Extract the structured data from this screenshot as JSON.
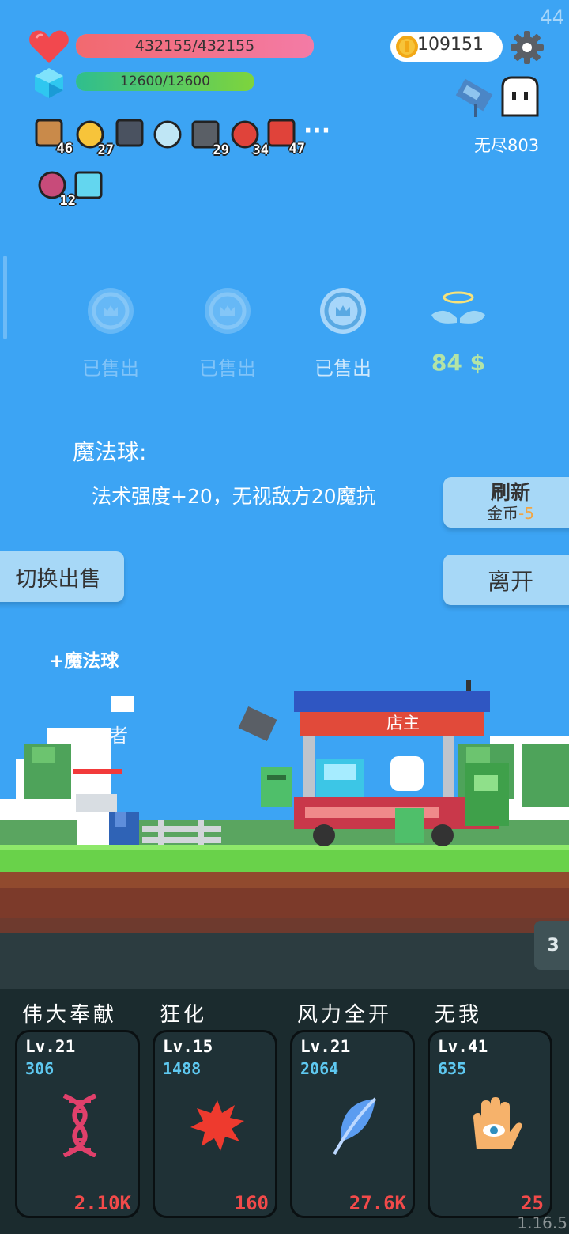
{
  "status": {
    "hp_text": "432155/432155",
    "hp_fraction": 1.0,
    "mana_text": "12600/12600",
    "mana_fraction": 1.0,
    "gold": "109151",
    "fps": "44",
    "stage": "无尽803",
    "version": "1.16.5"
  },
  "inventory": [
    {
      "icon": "shield-item-icon",
      "count": "46"
    },
    {
      "icon": "sun-item-icon",
      "count": "27"
    },
    {
      "icon": "skull-book-item-icon",
      "count": ""
    },
    {
      "icon": "magnifier-item-icon",
      "count": ""
    },
    {
      "icon": "bat-item-icon",
      "count": "29"
    },
    {
      "icon": "sock-item-icon",
      "count": "34"
    },
    {
      "icon": "apple-item-icon",
      "count": "47"
    },
    {
      "icon": "sword-item-icon",
      "count": "12"
    },
    {
      "icon": "lamp-item-icon",
      "count": ""
    }
  ],
  "more_label": "···",
  "shop": {
    "slots": [
      {
        "label": "已售出"
      },
      {
        "label": "已售出"
      },
      {
        "label": "已售出"
      },
      {
        "label": "84 $"
      }
    ],
    "item_title": "魔法球:",
    "item_desc": "法术强度+20，无视敌方20魔抗",
    "refresh_label": "刷新",
    "refresh_cost_label": "金币",
    "refresh_cost_value": "-5",
    "switch_label": "切换出售",
    "leave_label": "离开"
  },
  "scene": {
    "gain_text": "+魔法球",
    "hero_tag": "者",
    "shopkeeper_label": "店主",
    "side_tab_number": "3"
  },
  "skills": [
    {
      "name": "伟大奉献",
      "level": "Lv.21",
      "power": "306",
      "cost": "2.10K",
      "icon": "dna-icon"
    },
    {
      "name": "狂化",
      "level": "Lv.15",
      "power": "1488",
      "cost": "160",
      "icon": "splat-icon"
    },
    {
      "name": "风力全开",
      "level": "Lv.21",
      "power": "2064",
      "cost": "27.6K",
      "icon": "feather-icon"
    },
    {
      "name": "无我",
      "level": "Lv.41",
      "power": "635",
      "cost": "25",
      "icon": "eye-hand-icon"
    }
  ],
  "colors": {
    "sky": "#3ca4f4",
    "hp_bar": "#f26a7a",
    "mana_bar": "#44c07a",
    "card_bg": "#1f3136",
    "cost_red": "#f24a4a",
    "power_blue": "#5ec8f0"
  }
}
